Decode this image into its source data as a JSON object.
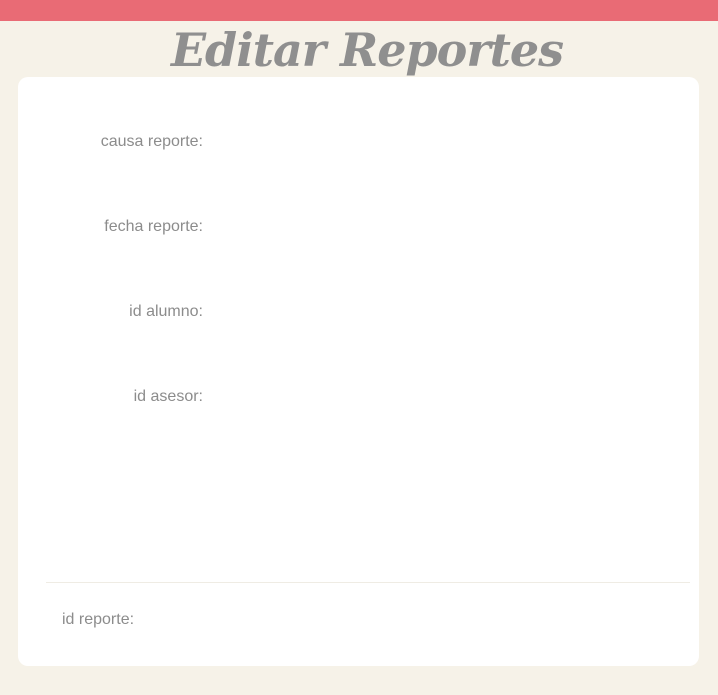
{
  "header": {
    "title": "Editar Reportes",
    "accent_color": "#e96b75",
    "background_color": "#f6f2e8"
  },
  "form": {
    "fields": [
      {
        "label": "causa reporte:",
        "value": ""
      },
      {
        "label": "fecha reporte:",
        "value": ""
      },
      {
        "label": "id alumno:",
        "value": ""
      },
      {
        "label": "id asesor:",
        "value": ""
      }
    ],
    "id_field": {
      "label": "id reporte:",
      "value": ""
    }
  }
}
